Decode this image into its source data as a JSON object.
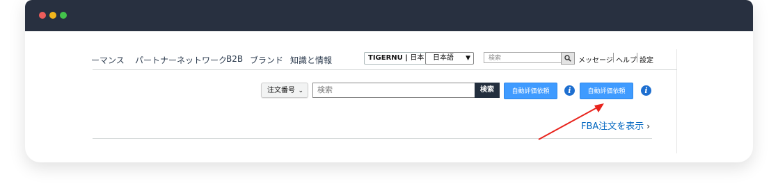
{
  "nav": {
    "items": [
      "ーマンス",
      "パートナーネットワーク",
      "B2B",
      "ブランド",
      "知識と情報"
    ]
  },
  "language": {
    "store": "TIGERNU",
    "region": "日本",
    "selected": "日本語"
  },
  "top_search": {
    "placeholder": "検索"
  },
  "utility": {
    "messages": "メッセージ",
    "help": "ヘルプ",
    "settings": "設定"
  },
  "toolbar": {
    "order_select_value": "注文番号",
    "search_placeholder": "検索",
    "search_button": "検索",
    "auto_review_button_1": "自動評価依頼",
    "auto_review_button_2": "自動評価依頼"
  },
  "fba_link": "FBA注文を表示",
  "icons": {
    "search": "search-icon",
    "info": "info-icon",
    "chevron": "chevron-down-icon",
    "arrow": "red-arrow-annotation"
  },
  "colors": {
    "titlebar": "#283040",
    "primary_button": "#3f9bff",
    "search_button": "#232f3e",
    "link": "#0066c0",
    "annotation": "#e8231c"
  }
}
